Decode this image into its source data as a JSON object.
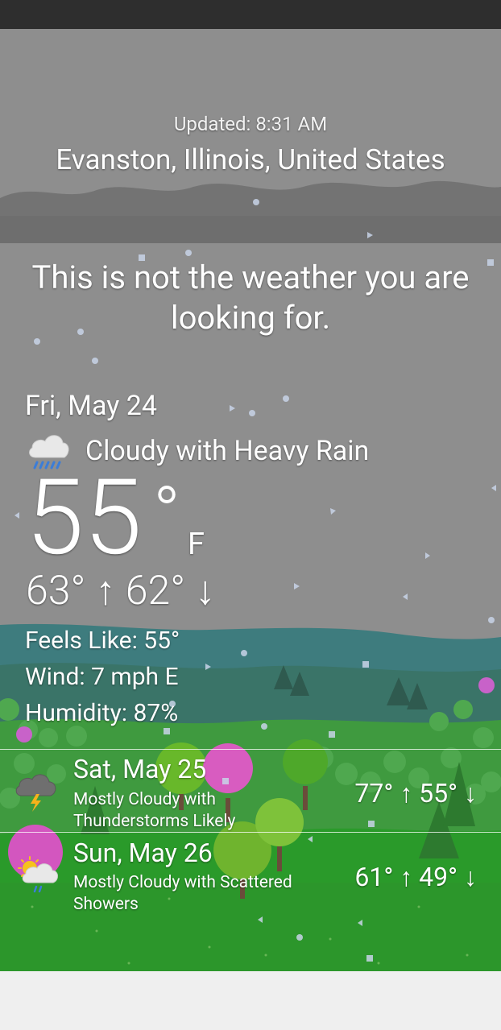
{
  "header": {
    "updated": "Updated: 8:31 AM",
    "location": "Evanston, Illinois, United States"
  },
  "tagline": "This is not the weather you are looking for.",
  "current": {
    "date": "Fri, May 24",
    "condition": "Cloudy with Heavy Rain",
    "condition_icon": "cloud-heavy-rain-icon",
    "temperature": "55",
    "degree_symbol": "°",
    "unit": "F",
    "hilo": "63° ↑ 62° ↓",
    "feels_like": "Feels Like: 55°",
    "wind": "Wind: 7 mph E",
    "humidity": "Humidity: 87%"
  },
  "forecast": [
    {
      "day": "Sat, May 25",
      "description": "Mostly Cloudy with Thunderstorms Likely",
      "range": "77° ↑ 55° ↓",
      "icon": "cloud-thunderstorm-icon"
    },
    {
      "day": "Sun, May 26",
      "description": "Mostly Cloudy with Scattered Showers",
      "range": "61° ↑ 49° ↓",
      "icon": "sun-cloud-showers-icon"
    }
  ],
  "colors": {
    "sky": "#8f8f8f",
    "cloud_band": "#6f6f6f",
    "hills": "#3f7f7f",
    "grass": "#2e9a2a",
    "text": "#ffffff"
  }
}
